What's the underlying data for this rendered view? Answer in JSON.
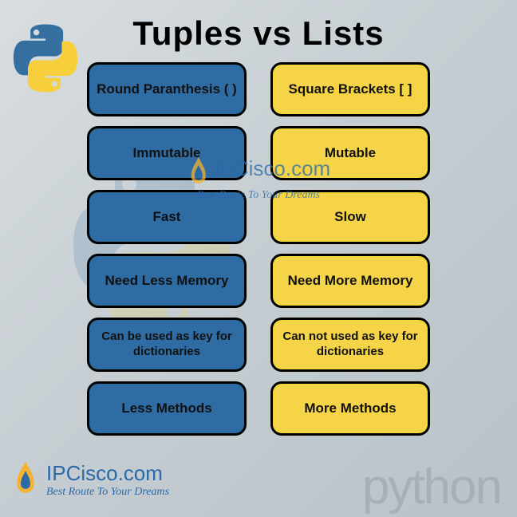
{
  "title": "Tuples  vs  Lists",
  "rows": [
    {
      "left": "Round Paranthesis ( )",
      "right": "Square Brackets [ ]"
    },
    {
      "left": "Immutable",
      "right": "Mutable"
    },
    {
      "left": "Fast",
      "right": "Slow"
    },
    {
      "left": "Need Less Memory",
      "right": "Need More Memory"
    },
    {
      "left": "Can be used as key for dictionaries",
      "right": "Can not used as key for dictionaries"
    },
    {
      "left": "Less Methods",
      "right": "More Methods"
    }
  ],
  "watermark": {
    "brand": "IPCisco.com",
    "tagline": "Best Route To Your Dreams"
  },
  "bottom_logo": {
    "brand": "IPCisco.com",
    "tagline": "Best Route To Your Dreams"
  },
  "python_word": "python",
  "colors": {
    "blue": "#2e6ca3",
    "yellow": "#f5d447"
  }
}
